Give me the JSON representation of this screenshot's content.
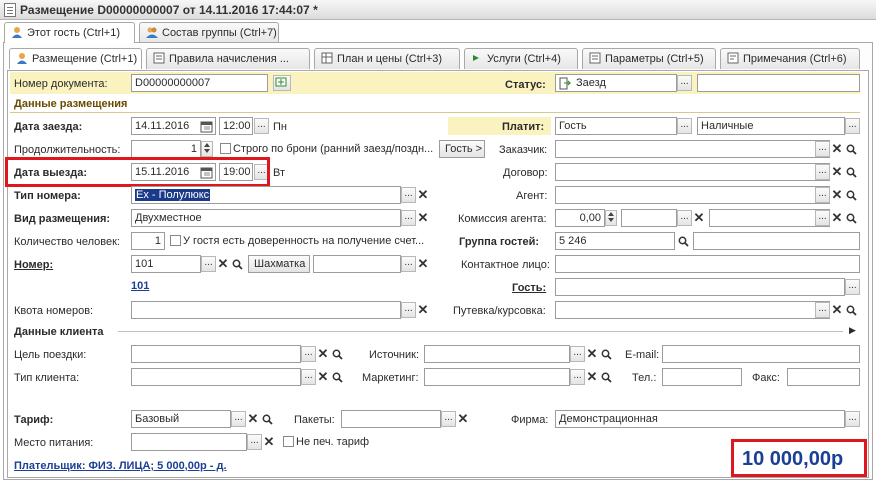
{
  "window": {
    "title": "Размещение D00000000007 от 14.11.2016 17:44:07 *"
  },
  "outer_tabs": [
    {
      "label": "Этот гость (Ctrl+1)",
      "icon": "guest-icon"
    },
    {
      "label": "Состав группы (Ctrl+7)",
      "icon": "group-icon"
    }
  ],
  "inner_tabs": [
    {
      "label": "Размещение (Ctrl+1)",
      "icon": "guest-icon"
    },
    {
      "label": "Правила начисления ...",
      "icon": "rules-icon"
    },
    {
      "label": "План и цены (Ctrl+3)",
      "icon": "table-icon"
    },
    {
      "label": "Услуги (Ctrl+4)",
      "icon": "services-arrow-icon"
    },
    {
      "label": "Параметры (Ctrl+5)",
      "icon": "params-icon"
    },
    {
      "label": "Примечания (Ctrl+6)",
      "icon": "notes-icon"
    }
  ],
  "form": {
    "doc_number_label": "Номер документа:",
    "doc_number": "D00000000007",
    "status_label": "Статус:",
    "status_value": "Заезд",
    "section_accommodation": "Данные размещения",
    "checkin_label": "Дата заезда:",
    "checkin_date": "14.11.2016",
    "checkin_time": "12:00",
    "checkin_day": "Пн",
    "payer_label": "Платит:",
    "payer_value": "Гость",
    "payment_method": "Наличные",
    "duration_label": "Продолжительность:",
    "duration_value": "1",
    "strict_booking_label": "Строго по брони (ранний заезд/поздн...",
    "guest_button": "Гость >",
    "customer_label": "Заказчик:",
    "checkout_label": "Дата выезда:",
    "checkout_date": "15.11.2016",
    "checkout_time": "19:00",
    "checkout_day": "Вт",
    "contract_label": "Договор:",
    "room_type_label": "Тип номера:",
    "room_type_value": "Ex - Полулюкс",
    "agent_label": "Агент:",
    "accommodation_type_label": "Вид размещения:",
    "accommodation_type_value": "Двухместное",
    "agent_commission_label": "Комиссия агента:",
    "agent_commission_value": "0,00",
    "people_count_label": "Количество человек:",
    "people_count_value": "1",
    "power_of_attorney_label": "У гостя есть доверенность на получение счет...",
    "guest_group_label": "Группа гостей:",
    "guest_group_value": "5 246",
    "room_label": "Номер:",
    "room_value": "101",
    "chess_button": "Шахматка",
    "contact_label": "Контактное лицо:",
    "room_link": "101",
    "guest_label": "Гость:",
    "room_quota_label": "Квота номеров:",
    "voucher_label": "Путевка/курсовка:",
    "section_client": "Данные клиента",
    "trip_purpose_label": "Цель поездки:",
    "source_label": "Источник:",
    "email_label": "E-mail:",
    "client_type_label": "Тип клиента:",
    "marketing_label": "Маркетинг:",
    "phone_label": "Тел.:",
    "fax_label": "Факс:",
    "tariff_label": "Тариф:",
    "tariff_value": "Базовый",
    "packages_label": "Пакеты:",
    "company_label": "Фирма:",
    "company_value": "Демонстрационная",
    "meal_place_label": "Место питания:",
    "no_print_tariff_label": "Не печ. тариф",
    "payer_link": "Плательщик: ФИЗ. ЛИЦА; 5 000,00р - д.",
    "total": "10 000,00р"
  },
  "colors": {
    "highlight": "#fbf3bf",
    "red_box": "#e0161e",
    "link": "#1a3f95",
    "section": "#6b4a00",
    "selected_text_bg": "#1c3a8c"
  }
}
